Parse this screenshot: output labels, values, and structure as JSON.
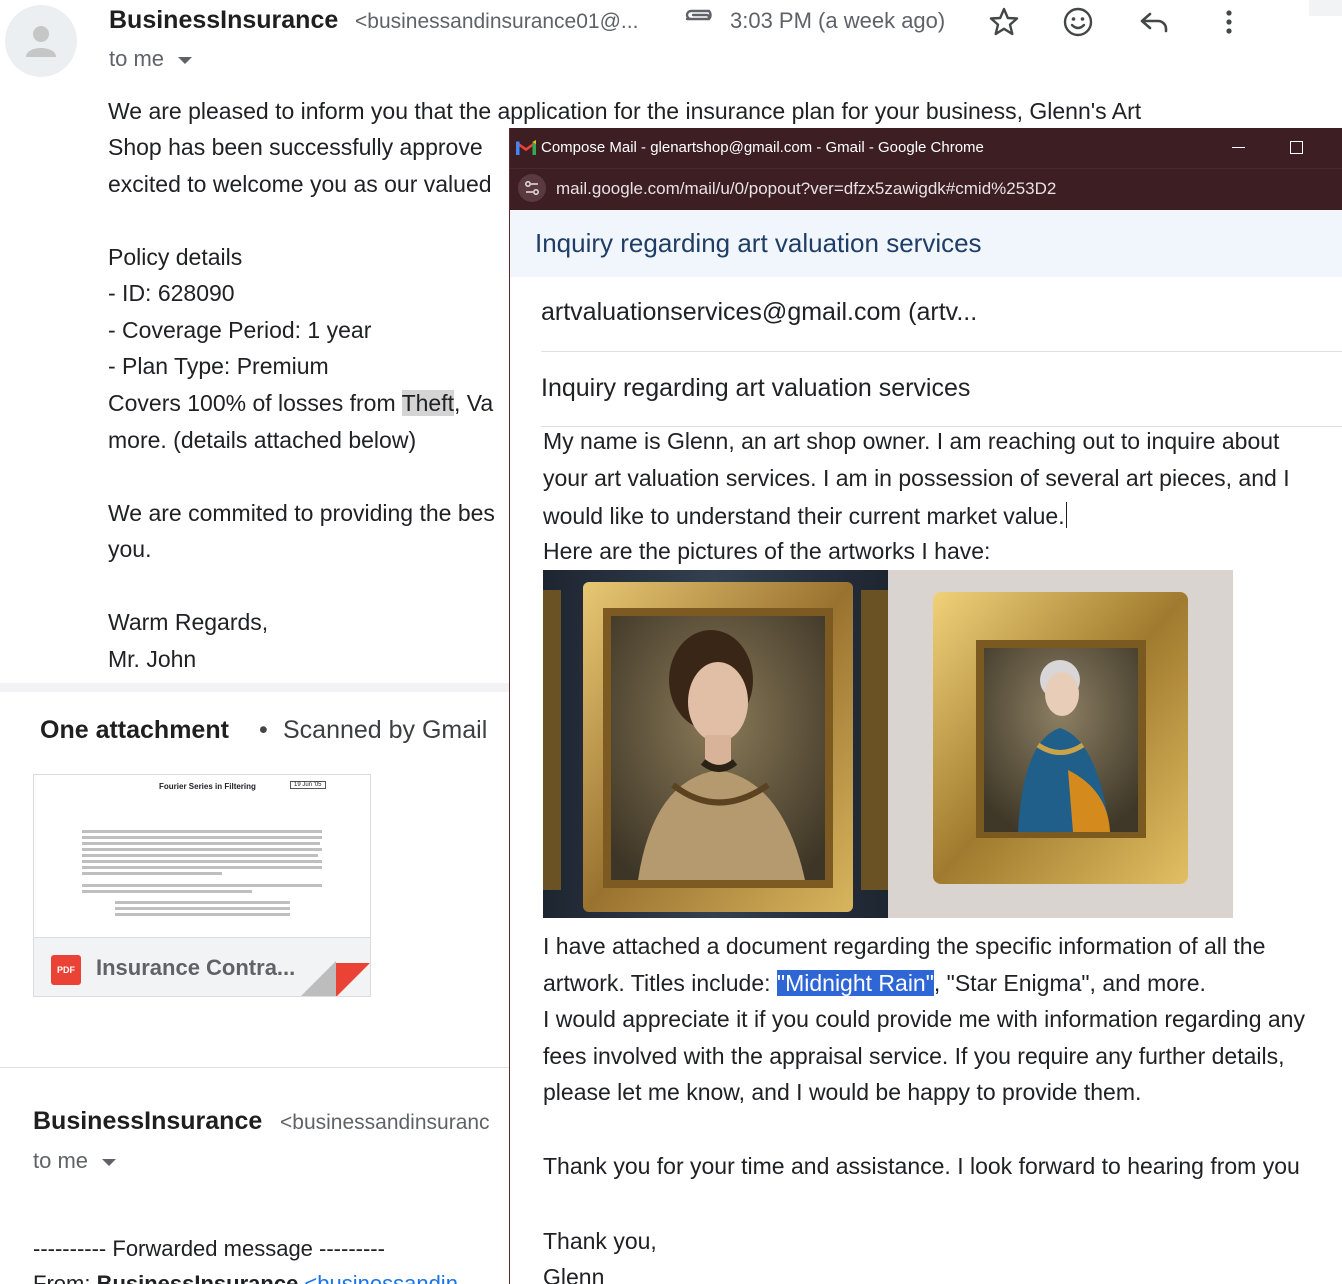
{
  "thread": {
    "message1": {
      "sender_name": "BusinessInsurance",
      "sender_email": "<businessandinsurance01@...",
      "time": "3:03 PM (a week ago)",
      "to_label": "to me",
      "body_lines": [
        "We are pleased to inform you that the application for the insurance plan for your business, Glenn's Art",
        "Shop has been successfully approve",
        "excited to welcome you as our valued",
        "Policy details",
        "- ID: 628090",
        "- Coverage Period: 1 year",
        "- Plan Type: Premium",
        "more. (details attached below)",
        "We are commited to providing the bes",
        "you.",
        "Warm Regards,",
        "Mr. John"
      ],
      "covers_prefix": "Covers 100% of losses from ",
      "covers_highlight": "Theft",
      "covers_suffix": ", Va"
    },
    "attachments": {
      "title": "One attachment",
      "separator": "•",
      "scanned": "Scanned by Gmail",
      "file": {
        "name": "Insurance Contra...",
        "type_badge": "PDF",
        "preview_title": "Fourier Series in Filtering",
        "preview_date": "19 Jun '05"
      }
    },
    "message2": {
      "sender_name": "BusinessInsurance",
      "sender_email": "<businessandinsuranc",
      "to_label": "to me",
      "forwarded": "---------- Forwarded message ---------",
      "from_label": "From: ",
      "from_name": "BusinessInsurance",
      "from_email": " <businessandin"
    }
  },
  "popup": {
    "window_title": "Compose Mail - glenartshop@gmail.com - Gmail - Google Chrome",
    "url": "mail.google.com/mail/u/0/popout?ver=dfzx5zawigdk#cmid%253D2",
    "subject_header": "Inquiry regarding art valuation services",
    "to": "artvaluationservices@gmail.com (artv...",
    "subject": "Inquiry regarding art valuation services",
    "body_lines_top": [
      "My name is Glenn, an art shop owner. I am reaching out to inquire about",
      "your art valuation services. I am in possession of several art pieces, and I",
      "would like to understand their current market value.",
      "Here are the pictures of the artworks I have:"
    ],
    "attached_line": "I have attached a document regarding the specific information of all the",
    "titles_prefix": "artwork. Titles include: ",
    "titles_selected": "\"Midnight Rain\"",
    "titles_suffix": ", \"Star Enigma\", and more.",
    "body_lines_bottom": [
      "I would appreciate it if you could provide me with information regarding any",
      "fees involved with the appraisal service. If you require any further details,",
      "please let me know, and I would be happy to provide them.",
      "Thank you for your time and assistance. I look forward to hearing from you",
      "Thank you,",
      "Glenn"
    ],
    "colors": {
      "titlebar": "#3c1e23",
      "selection": "#2e66d6",
      "subject_bar": "#f1f5fc"
    }
  }
}
